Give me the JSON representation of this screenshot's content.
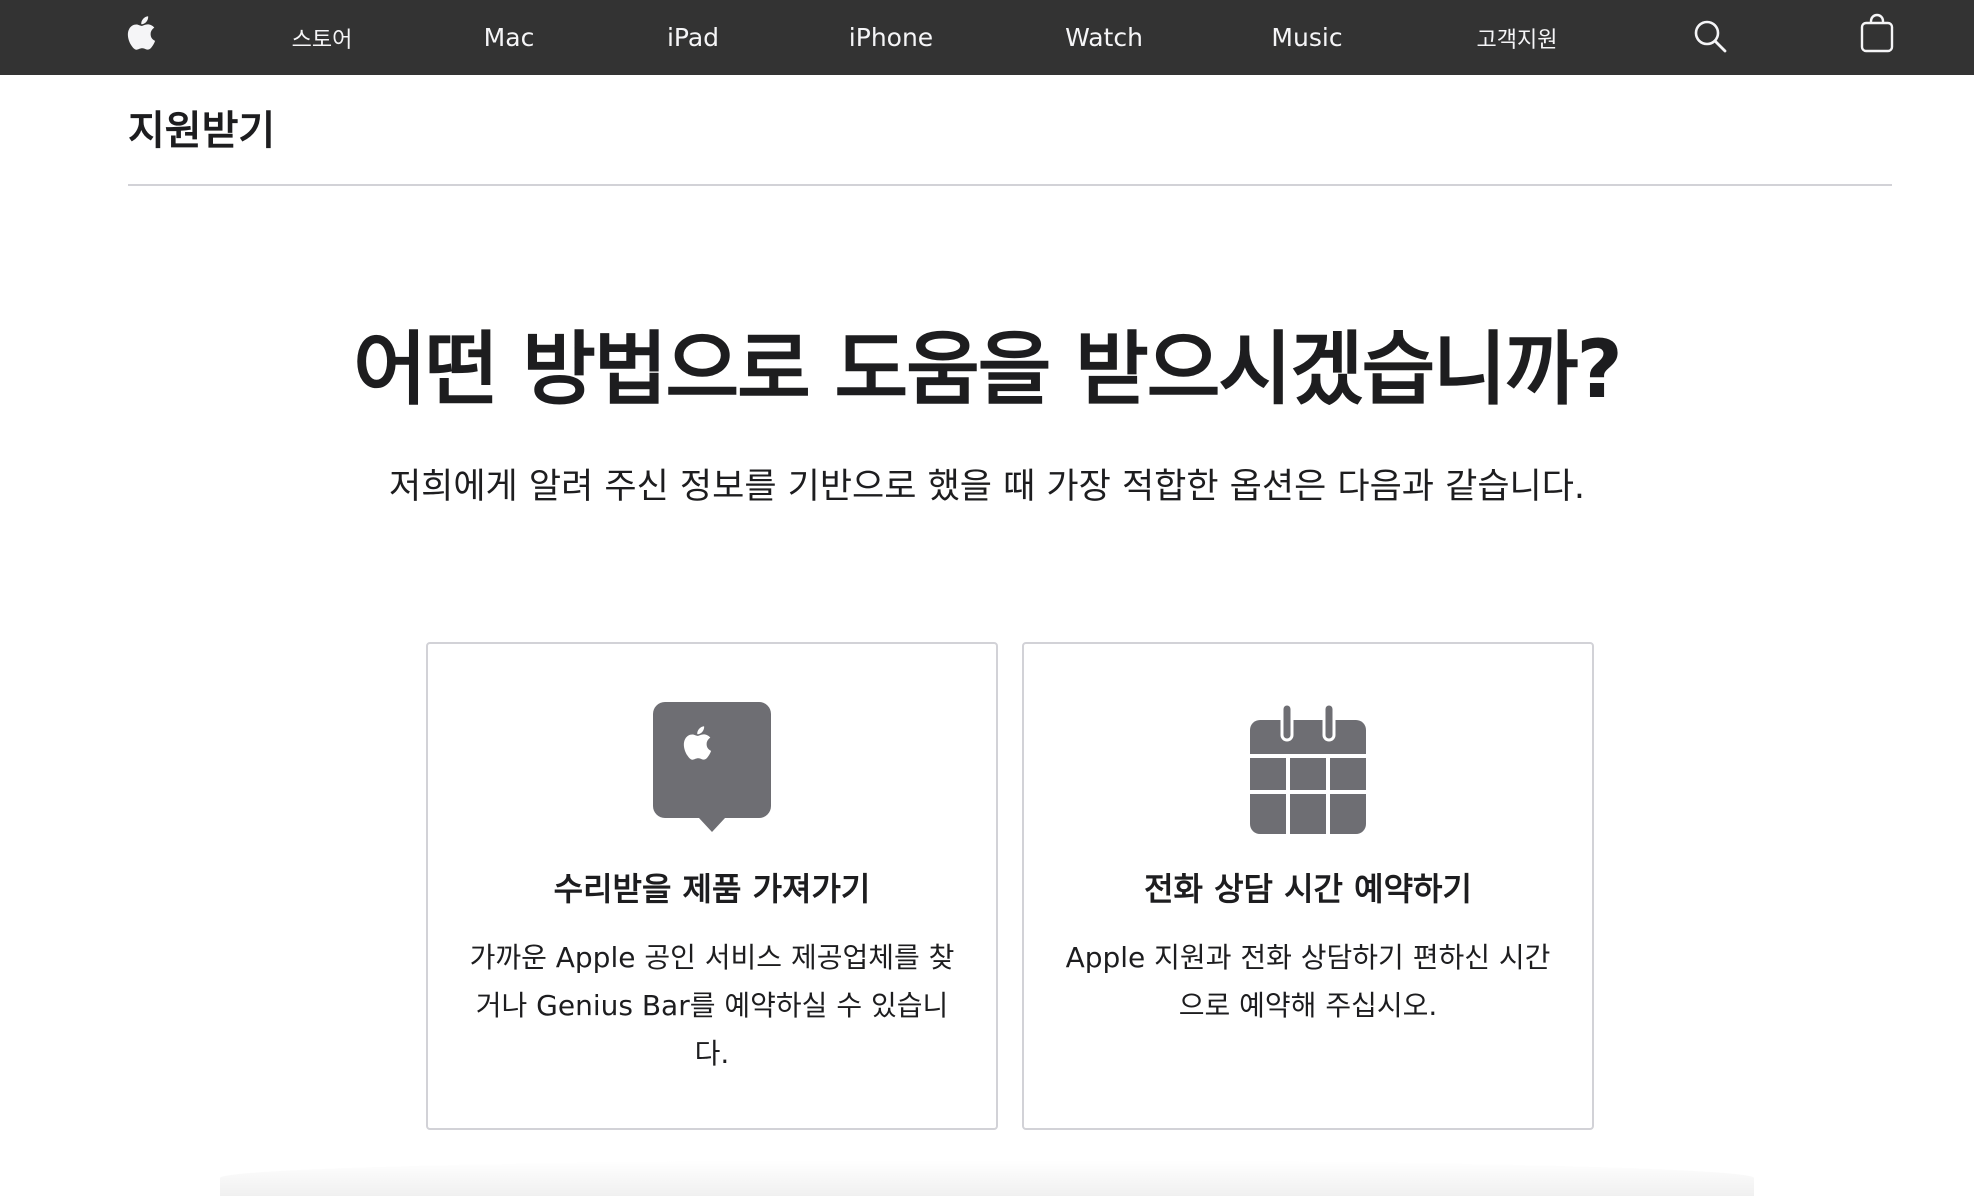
{
  "nav": {
    "items": [
      {
        "key": "store",
        "label": "스토어"
      },
      {
        "key": "mac",
        "label": "Mac"
      },
      {
        "key": "ipad",
        "label": "iPad"
      },
      {
        "key": "iphone",
        "label": "iPhone"
      },
      {
        "key": "watch",
        "label": "Watch"
      },
      {
        "key": "music",
        "label": "Music"
      },
      {
        "key": "support",
        "label": "고객지원"
      }
    ],
    "icons": [
      "apple-logo-icon",
      "search-icon",
      "bag-icon"
    ],
    "background": "#333333",
    "text_color": "#f5f5f7"
  },
  "localnav": {
    "title": "지원받기"
  },
  "hero": {
    "title": "어떤 방법으로 도움을 받으시겠습니까?",
    "subtitle": "저희에게 알려 주신 정보를 기반으로 했을 때 가장 적합한 옵션은 다음과 같습니다."
  },
  "options": [
    {
      "icon": "apple-store-pin-icon",
      "title": "수리받을 제품 가져가기",
      "description": "가까운 Apple 공인 서비스 제공업체를 찾거나 Genius Bar를 예약하실 수 있습니다."
    },
    {
      "icon": "calendar-icon",
      "title": "전화 상담 시간 예약하기",
      "description": "Apple 지원과 전화 상담하기 편하신 시간으로 예약해 주십시오."
    }
  ],
  "colors": {
    "icon_gray": "#6e6e73",
    "border": "#d2d2d7",
    "text": "#1d1d1f"
  }
}
